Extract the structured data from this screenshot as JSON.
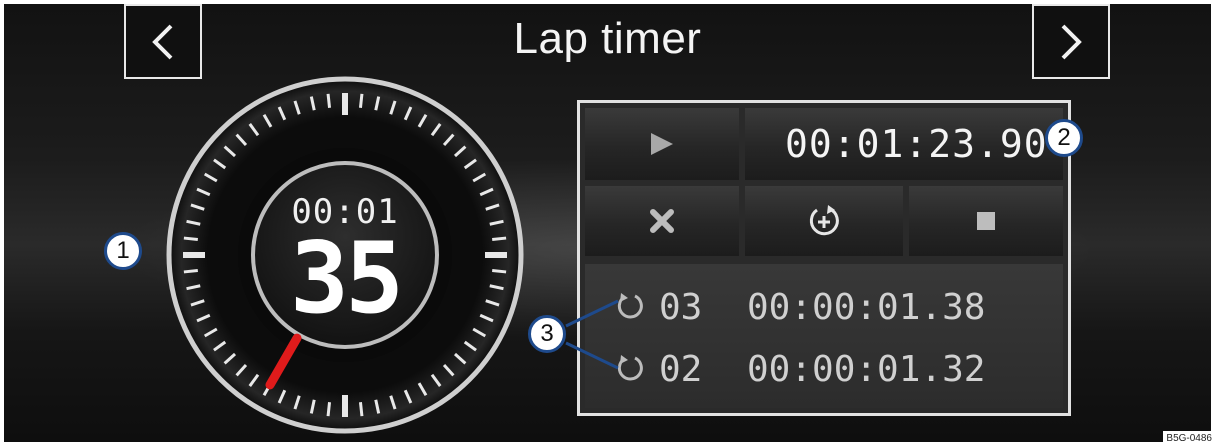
{
  "header": {
    "title": "Lap timer"
  },
  "gauge": {
    "time": "00:01",
    "seconds": "35"
  },
  "controls": {
    "current_time": "00:01:23.90"
  },
  "laps": [
    {
      "number": "03",
      "time": "00:00:01.38"
    },
    {
      "number": "02",
      "time": "00:00:01.32"
    }
  ],
  "callouts": {
    "c1": "1",
    "c2": "2",
    "c3": "3"
  },
  "figure_code": "B5G-0486",
  "colors": {
    "background": "#1a1a1a",
    "needle": "#e01b1b",
    "callout_border": "#1e4a8c"
  }
}
